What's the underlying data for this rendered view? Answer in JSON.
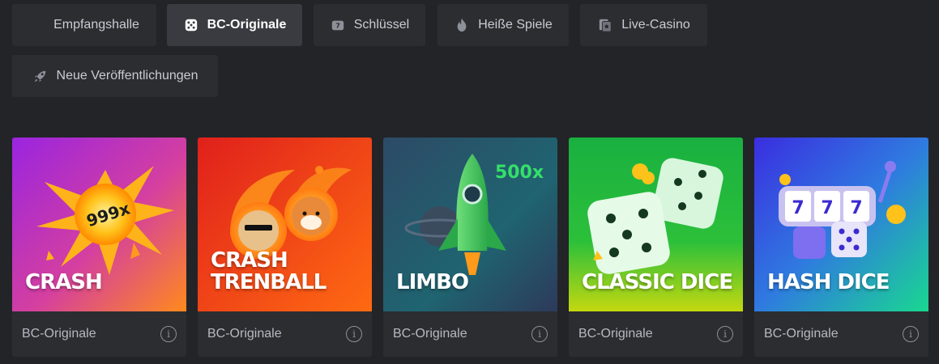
{
  "tabs": [
    {
      "label": "Empfangshalle",
      "icon": "lobby-icon",
      "active": false
    },
    {
      "label": "BC-Originale",
      "icon": "dice-icon",
      "active": true
    },
    {
      "label": "Schlüssel",
      "icon": "slot-icon",
      "active": false
    },
    {
      "label": "Heiße Spiele",
      "icon": "fire-icon",
      "active": false
    },
    {
      "label": "Live-Casino",
      "icon": "cards-icon",
      "active": false
    },
    {
      "label": "Neue Veröffentlichungen",
      "icon": "rocket-icon",
      "active": false
    }
  ],
  "games": [
    {
      "title": "CRASH",
      "provider": "BC-Originale",
      "badge": "999x",
      "theme_colors": [
        "#b02bd6",
        "#ff9a1f"
      ]
    },
    {
      "title": "CRASH\nTRENBALL",
      "provider": "BC-Originale",
      "theme_colors": [
        "#e8231d",
        "#ff7a12"
      ]
    },
    {
      "title": "LIMBO",
      "provider": "BC-Originale",
      "badge": "500x",
      "theme_colors": [
        "#1f5a6b",
        "#2f3b57"
      ]
    },
    {
      "title": "CLASSIC DICE",
      "provider": "BC-Originale",
      "theme_colors": [
        "#1bb63c",
        "#c4d60c"
      ]
    },
    {
      "title": "HASH DICE",
      "provider": "BC-Originale",
      "theme_colors": [
        "#3a2ee0",
        "#19d38a"
      ]
    }
  ],
  "info_icon": "i"
}
